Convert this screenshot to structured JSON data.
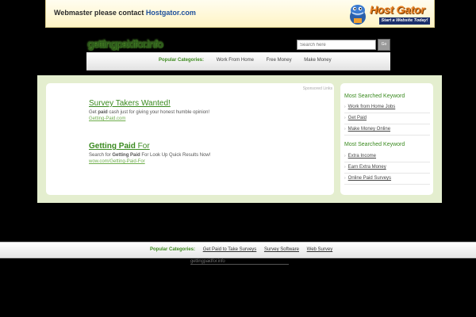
{
  "banner": {
    "text": "Webmaster please contact",
    "link": "Hostgator.com",
    "logo_title": "Host Gator",
    "logo_tagline": "Start a Website Today!"
  },
  "header": {
    "search_placeholder": "Search here",
    "search_button": "Go"
  },
  "top_categories": {
    "label": "Popular Categories:",
    "items": [
      "Work From Home",
      "Free Money",
      "Make Money"
    ]
  },
  "results": {
    "sponsored_label": "Sponsored Links",
    "ads": [
      {
        "title": "Survey Takers Wanted!",
        "desc_pre": "Get ",
        "desc_bold": "paid",
        "desc_post": " cash just for giving your honest humble opinion!",
        "url": "Getting-Paid.com"
      },
      {
        "title_bold": "Getting Paid",
        "title_rest": " For",
        "desc_pre": "Search for ",
        "desc_bold": "Getting Paid",
        "desc_post": " For Look Up Quick Results Now!",
        "url": "wow.com/Getting-Paid-For"
      }
    ]
  },
  "sidebar": {
    "groups": [
      {
        "heading": "Most Searched Keyword",
        "items": [
          "Work from Home Jobs",
          "Get Paid",
          "Make Money Online"
        ]
      },
      {
        "heading": "Most Searched Keyword",
        "items": [
          "Extra Income",
          "Earn Extra Money",
          "Online Paid Surveys"
        ]
      }
    ]
  },
  "footer": {
    "label": "Popular Categories:",
    "items": [
      "Get Paid to Take Surveys",
      "Survey Software",
      "Web Survey"
    ]
  }
}
